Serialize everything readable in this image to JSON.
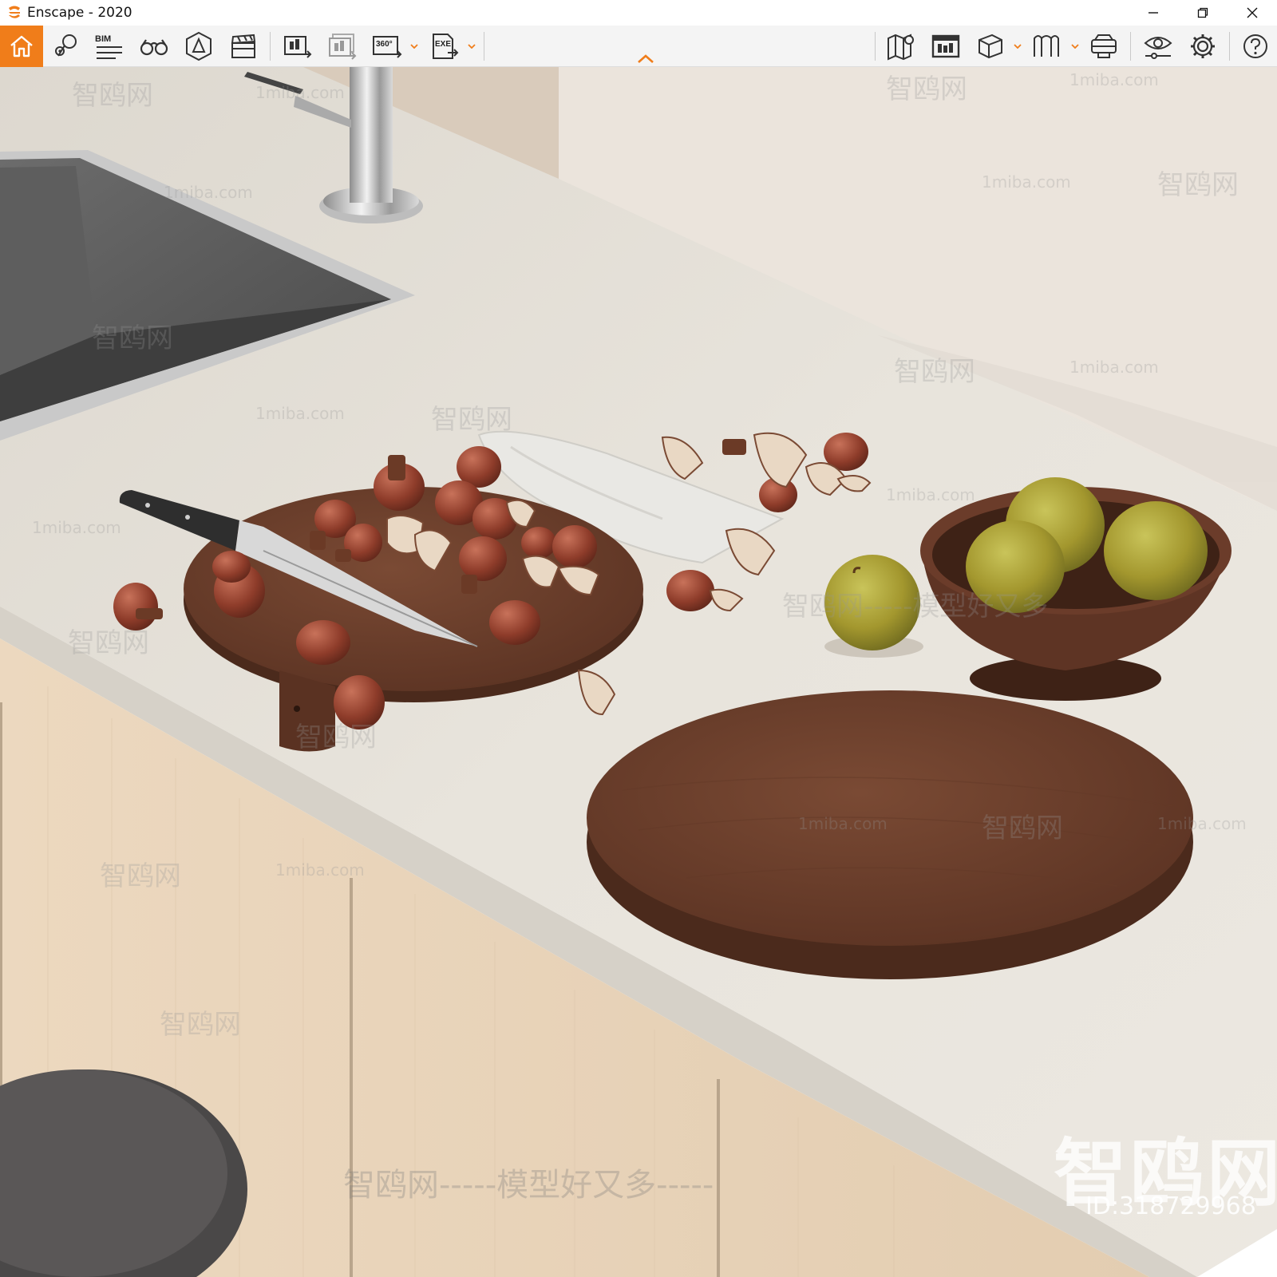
{
  "window": {
    "title": "Enscape - 2020",
    "accent_color": "#f07d1a",
    "controls": [
      "minimize-icon",
      "restore-icon",
      "close-icon"
    ]
  },
  "toolbar": {
    "bim_label": "BIM",
    "pano_label": "360°",
    "exe_label": "EXE",
    "left_tools": [
      "home-icon",
      "location-pin-icon",
      "bim-menu-icon",
      "binoculars-icon",
      "render-mode-icon",
      "video-editor-icon",
      "screenshot-export-icon",
      "batch-render-icon",
      "panorama-360-icon",
      "standalone-exe-icon"
    ],
    "right_tools": [
      "map-icon",
      "asset-library-icon",
      "view-cube-icon",
      "book-icon",
      "vr-headset-icon",
      "visual-settings-icon",
      "settings-gear-icon",
      "help-icon"
    ]
  },
  "scene": {
    "description_labels": {
      "sink": "stainless sink",
      "faucet": "chrome faucet",
      "board_small": "wooden cutting board with mushrooms",
      "board_round": "round wooden board",
      "bowl": "wooden bowl with apples",
      "stool": "bar stool"
    },
    "watermarks": {
      "site": "1miba.com",
      "brand": "智鸥网",
      "slogan": "智鸥网-----模型好又多",
      "dash_slogan": "智鸥网-----模型好又多-----",
      "big_brand": "智鸥网",
      "id": "ID:318729968"
    }
  }
}
